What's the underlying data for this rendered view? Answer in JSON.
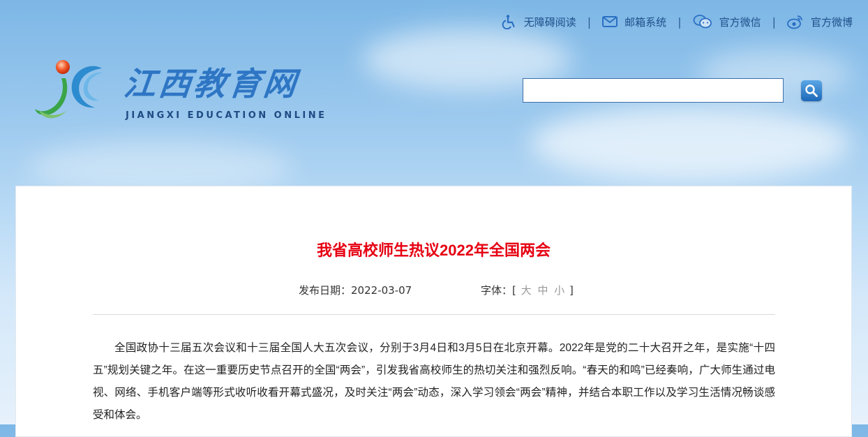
{
  "toplinks": {
    "accessibility": "无障碍阅读",
    "mail": "邮箱系统",
    "wechat": "官方微信",
    "weibo": "官方微博",
    "separator": "|"
  },
  "logo": {
    "title": "江西教育网",
    "subtitle": "JIANGXI EDUCATION ONLINE"
  },
  "search": {
    "value": "",
    "placeholder": ""
  },
  "article": {
    "title": "我省高校师生热议2022年全国两会",
    "date_label": "发布日期：",
    "date": "2022-03-07",
    "font_label": "字体：",
    "font_open": "[",
    "font_large": "大",
    "font_medium": "中",
    "font_small": "小",
    "font_close": "]",
    "paragraph1": "全国政协十三届五次会议和十三届全国人大五次会议，分别于3月4日和3月5日在北京开幕。2022年是党的二十大召开之年，是实施“十四五”规划关键之年。在这一重要历史节点召开的全国“两会”，引发我省高校师生的热切关注和强烈反响。“春天的和鸣”已经奏响，广大师生通过电视、网络、手机客户端等形式收听收看开幕式盛况，及时关注“两会”动态，深入学习领会“两会”精神，并结合本职工作以及学习生活情况畅谈感受和体会。"
  },
  "colors": {
    "title_red": "#e60012",
    "link_blue": "#1d4f8a",
    "logo_blue": "#2e76c4"
  },
  "icons": [
    "accessibility-icon",
    "mail-icon",
    "wechat-icon",
    "weibo-icon",
    "search-icon"
  ]
}
